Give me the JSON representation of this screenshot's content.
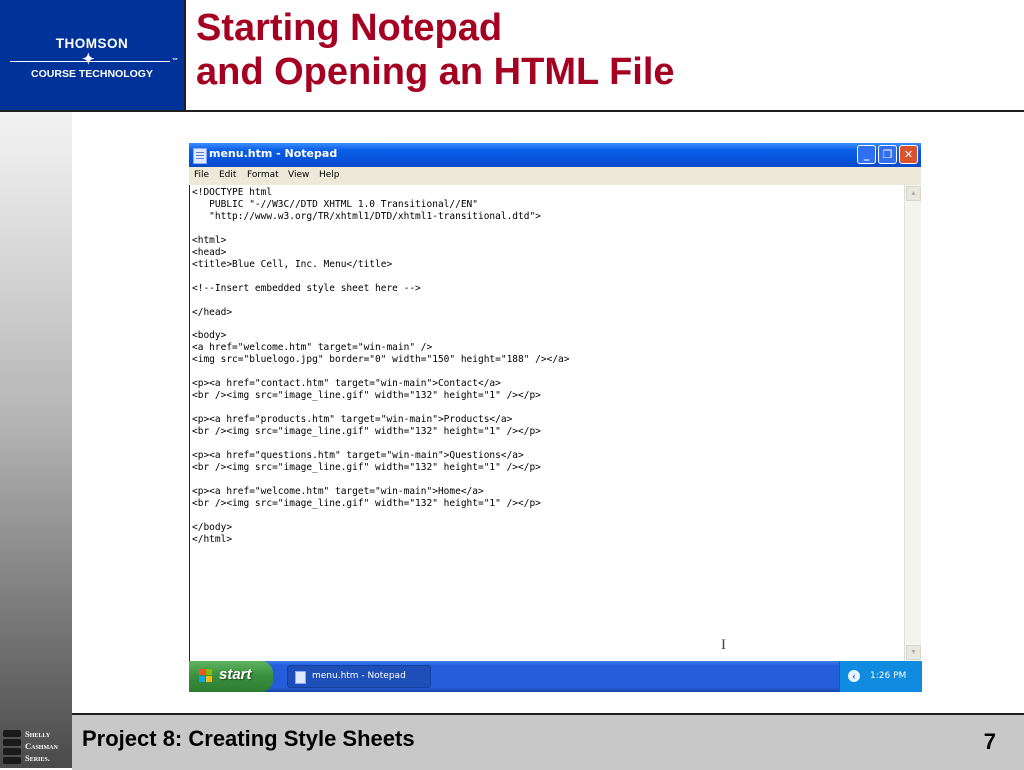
{
  "slide": {
    "title_line1": "Starting Notepad",
    "title_line2": "and Opening an HTML File",
    "footer_text": "Project 8: Creating Style Sheets",
    "page_number": "7",
    "logo": {
      "line1": "THOMSON",
      "line2": "COURSE TECHNOLOGY",
      "tm": "™"
    },
    "series_logo": [
      "Shelly",
      "Cashman",
      "Series."
    ]
  },
  "window": {
    "title": "menu.htm - Notepad",
    "buttons": {
      "minimize": "_",
      "maximize": "❐",
      "close": "✕"
    },
    "menu": [
      "File",
      "Edit",
      "Format",
      "View",
      "Help"
    ],
    "editor_text": "<!DOCTYPE html\n   PUBLIC \"-//W3C//DTD XHTML 1.0 Transitional//EN\"\n   \"http://www.w3.org/TR/xhtml1/DTD/xhtml1-transitional.dtd\">\n\n<html>\n<head>\n<title>Blue Cell, Inc. Menu</title>\n\n<!--Insert embedded style sheet here -->\n\n</head>\n\n<body>\n<a href=\"welcome.htm\" target=\"win-main\" />\n<img src=\"bluelogo.jpg\" border=\"0\" width=\"150\" height=\"188\" /></a>\n\n<p><a href=\"contact.htm\" target=\"win-main\">Contact</a>\n<br /><img src=\"image_line.gif\" width=\"132\" height=\"1\" /></p>\n\n<p><a href=\"products.htm\" target=\"win-main\">Products</a>\n<br /><img src=\"image_line.gif\" width=\"132\" height=\"1\" /></p>\n\n<p><a href=\"questions.htm\" target=\"win-main\">Questions</a>\n<br /><img src=\"image_line.gif\" width=\"132\" height=\"1\" /></p>\n\n<p><a href=\"welcome.htm\" target=\"win-main\">Home</a>\n<br /><img src=\"image_line.gif\" width=\"132\" height=\"1\" /></p>\n\n</body>\n</html>"
  },
  "taskbar": {
    "start_label": "start",
    "task_label": "menu.htm - Notepad",
    "clock": "1:26 PM"
  },
  "colors": {
    "title_red": "#a50021",
    "logo_blue": "#003399",
    "footer_gray": "#c8c8c8",
    "xp_title_blue": "#0553d9",
    "start_green": "#388e3c"
  }
}
